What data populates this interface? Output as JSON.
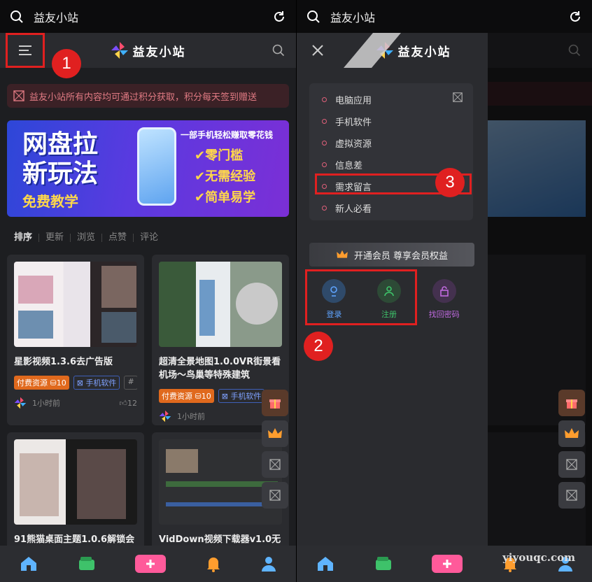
{
  "search": {
    "query": "益友小站"
  },
  "site": {
    "name": "益友小站"
  },
  "notice": {
    "text": "益友小站所有内容均可通过积分获取，积分每天签到赠送"
  },
  "banner": {
    "headline": "网盘拉新玩法",
    "free": "免费教学",
    "sub": "一部手机轻松赚取零花钱",
    "features": [
      "✔零门槛",
      "✔无需经验",
      "✔简单易学"
    ]
  },
  "sort": {
    "items": [
      "排序",
      "更新",
      "浏览",
      "点赞",
      "评论"
    ]
  },
  "posts": [
    {
      "title": "星影视频1.3.6去广告版",
      "pay": "付费资源 ⛁10",
      "category": "手机软件",
      "more": "#",
      "time": "1小时前",
      "likes": "12"
    },
    {
      "title": "超清全景地图1.0.0VR街景看机场～鸟巢等特殊建筑",
      "pay": "付费资源 ⛁10",
      "category": "手机软件",
      "time": "1小时前"
    },
    {
      "title": "91熊猫桌面主题1.0.6解锁会"
    },
    {
      "title": "VidDown视频下载器v1.0无"
    }
  ],
  "drawer": {
    "categories": [
      "电脑应用",
      "手机软件",
      "虚拟资源",
      "信息差",
      "需求留言",
      "新人必看"
    ],
    "vip_text": "开通会员 尊享会员权益",
    "login": "登录",
    "register": "注册",
    "recover": "找回密码"
  },
  "annotations": {
    "one": "1",
    "two": "2",
    "three": "3"
  },
  "watermark": "yiyouqc.com",
  "colors": {
    "highlight": "#e02020",
    "accent_pink": "#e0607a"
  }
}
